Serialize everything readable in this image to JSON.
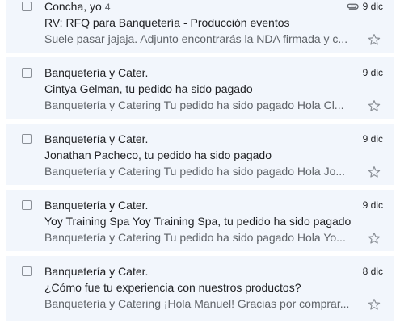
{
  "emails": [
    {
      "sender": "Concha, yo",
      "thread_count": "4",
      "subject": "RV: RFQ para Banquetería - Producción eventos",
      "snippet": "Suele pasar jajaja. Adjunto encontrarás la NDA firmada y c...",
      "date": "9 dic",
      "has_attachment": true,
      "icon": "paperclip-icon"
    },
    {
      "sender": "Banquetería y Cater.",
      "subject": "Cintya Gelman, tu pedido ha sido pagado",
      "snippet": "Banquetería y Catering Tu pedido ha sido pagado Hola Cl...",
      "date": "9 dic"
    },
    {
      "sender": "Banquetería y Cater.",
      "subject": "Jonathan Pacheco, tu pedido ha sido pagado",
      "snippet": "Banquetería y Catering Tu pedido ha sido pagado Hola Jo...",
      "date": "9 dic"
    },
    {
      "sender": "Banquetería y Cater.",
      "subject": "Yoy Training Spa Yoy Training Spa, tu pedido ha sido pagado",
      "snippet": "Banquetería y Catering Tu pedido ha sido pagado Hola Yo...",
      "date": "9 dic"
    },
    {
      "sender": "Banquetería y Cater.",
      "subject": "¿Cómo fue tu experiencia con nuestros productos?",
      "snippet": "Banquetería y Catering ¡Hola Manuel! Gracias por comprar...",
      "date": "8 dic"
    }
  ],
  "colors": {
    "row_background": "#f2f6fc",
    "text_primary": "#202124",
    "text_secondary": "#5f6368",
    "icon_gray": "#8a8f96"
  },
  "icons": {
    "star": "star-outline-icon",
    "checkbox": "checkbox-icon",
    "attachment": "paperclip-icon"
  }
}
